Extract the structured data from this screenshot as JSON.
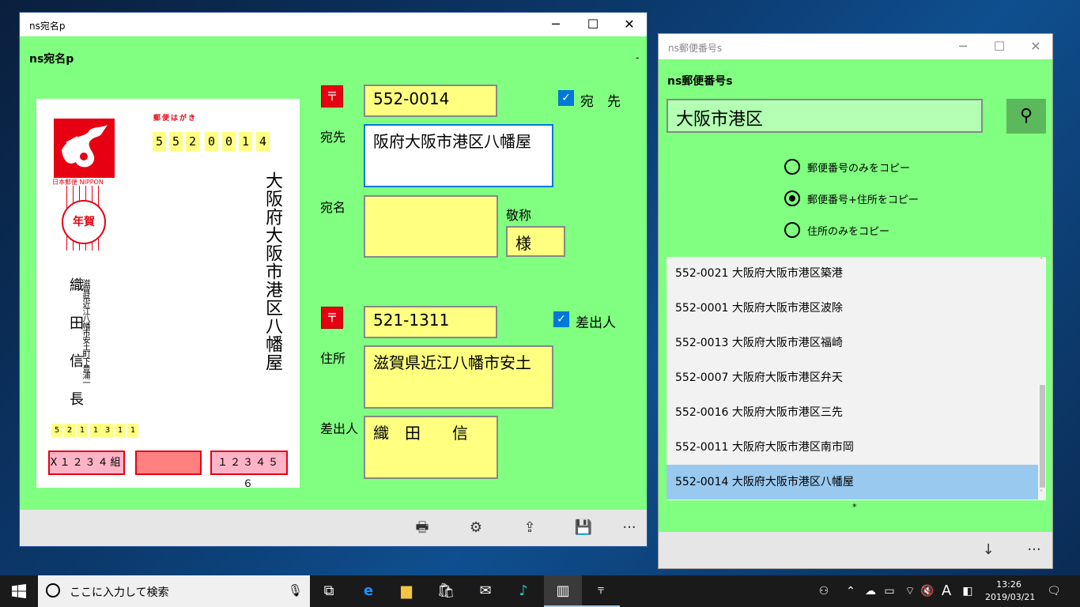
{
  "win1": {
    "title": "ns宛名p",
    "app_title": "ns宛名p",
    "dash": "-",
    "card": {
      "stamp_text": "日本郵便 NIPPON",
      "postmark": "年賀",
      "hagaki": "郵便はがき",
      "zip_digits": [
        "5",
        "5",
        "2",
        "0",
        "0",
        "1",
        "4"
      ],
      "address_vertical": "大阪府大阪市港区八幡屋",
      "sender_name_vertical": "織田信長",
      "sender_address_vertical": "滋賀県近江八幡市安土町下豊浦一",
      "sender_zip_digits": [
        "5",
        "2",
        "1",
        "1",
        "3",
        "1",
        "1"
      ],
      "box1": "X１２３４組",
      "box3": "１２３４５６"
    },
    "to": {
      "postmark_icon": "〒",
      "zip": "552-0014",
      "check_label": "宛　先",
      "address_label": "宛先",
      "address": "阪府大阪市港区八幡屋",
      "name_label": "宛名",
      "name": "",
      "honorific_label": "敬称",
      "honorific": "様"
    },
    "from": {
      "postmark_icon": "〒",
      "zip": "521-1311",
      "check_label": "差出人",
      "address_label": "住所",
      "address": "滋賀県近江八幡市安土",
      "name_label": "差出人",
      "name": "織　田　　信"
    },
    "cmds": {
      "print_icon": "🖶",
      "settings_icon": "⚙",
      "export_icon": "⇪",
      "save_icon": "💾",
      "more": "···"
    }
  },
  "win2": {
    "title": "ns郵便番号s",
    "app_title": "ns郵便番号s",
    "search_value": "大阪市港区",
    "search_icon": "⚲",
    "radio_options": [
      {
        "label": "郵便番号のみをコピー",
        "selected": false
      },
      {
        "label": "郵便番号+住所をコピー",
        "selected": true
      },
      {
        "label": "住所のみをコピー",
        "selected": false
      }
    ],
    "results": [
      "552-0021 大阪府大阪市港区築港",
      "552-0001 大阪府大阪市港区波除",
      "552-0013 大阪府大阪市港区福崎",
      "552-0007 大阪府大阪市港区弁天",
      "552-0016 大阪府大阪市港区三先",
      "552-0011 大阪府大阪市港区南市岡",
      "552-0014 大阪府大阪市港区八幡屋"
    ],
    "selected_index": 6,
    "footer_mark": "*",
    "cmds": {
      "download_icon": "↓",
      "more": "···"
    }
  },
  "taskbar": {
    "search_placeholder": "ここに入力して検索",
    "time": "13:26",
    "date": "2019/03/21",
    "ime": "A"
  },
  "colors": {
    "card_red": "#e60012",
    "field_yellow": "#ffff80",
    "app_green": "#80ff80",
    "accent": "#0078d7"
  }
}
